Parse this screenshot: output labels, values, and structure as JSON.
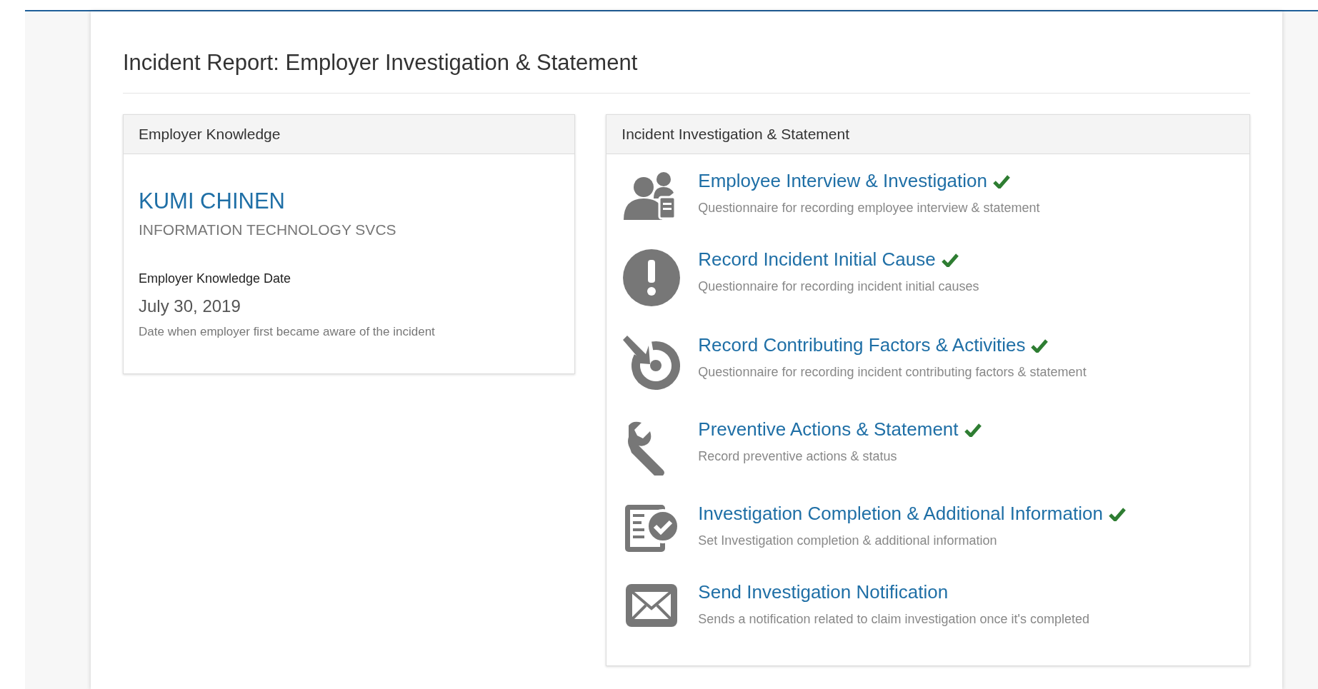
{
  "page": {
    "title": "Incident Report: Employer Investigation & Statement"
  },
  "employer_panel": {
    "header": "Employer Knowledge",
    "employee_name": "KUMI CHINEN",
    "department": "INFORMATION TECHNOLOGY SVCS",
    "date_label": "Employer Knowledge Date",
    "date_value": "July 30, 2019",
    "date_help": "Date when employer first became aware of the incident"
  },
  "investigation_panel": {
    "header": "Incident Investigation & Statement",
    "tasks": [
      {
        "kind": "interview",
        "title": "Employee Interview & Investigation",
        "description": "Questionnaire for recording employee interview & statement",
        "completed": true
      },
      {
        "kind": "cause",
        "title": "Record Incident Initial Cause",
        "description": "Questionnaire for recording incident initial causes",
        "completed": true
      },
      {
        "kind": "factors",
        "title": "Record Contributing Factors & Activities",
        "description": "Questionnaire for recording incident contributing factors & statement",
        "completed": true
      },
      {
        "kind": "preventive",
        "title": "Preventive Actions & Statement",
        "description": "Record preventive actions & status",
        "completed": true
      },
      {
        "kind": "completion",
        "title": "Investigation Completion & Additional Information",
        "description": "Set Investigation completion & additional information",
        "completed": true
      },
      {
        "kind": "notification",
        "title": "Send Investigation Notification",
        "description": "Sends a notification related to claim investigation once it's completed",
        "completed": false
      }
    ]
  }
}
